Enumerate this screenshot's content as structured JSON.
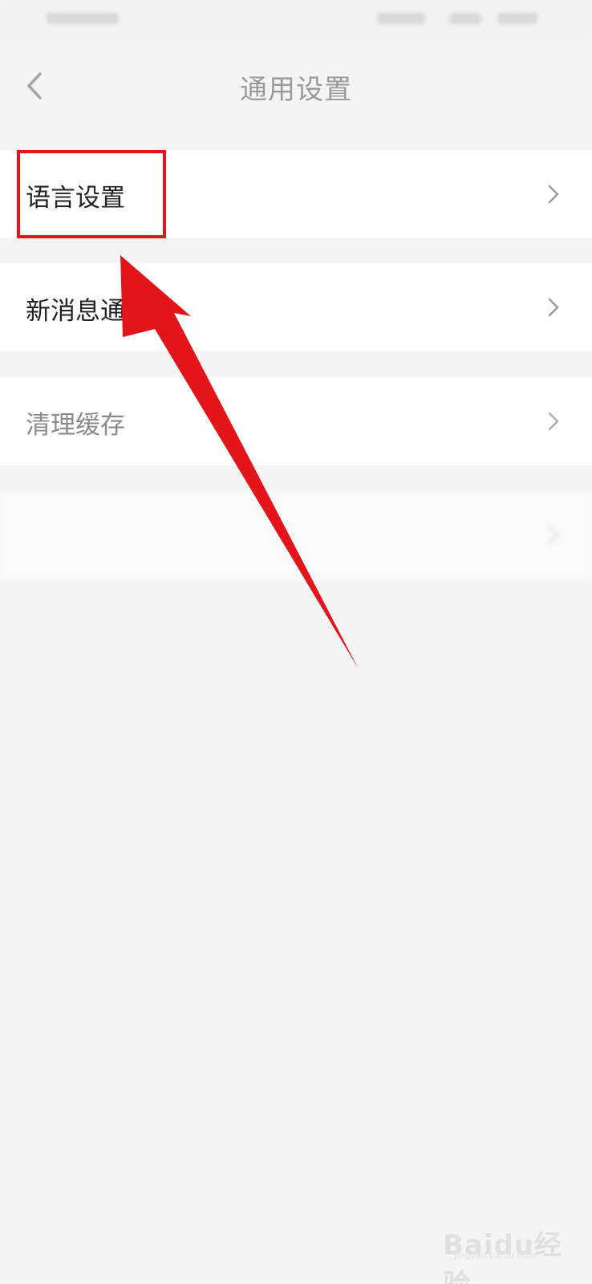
{
  "header": {
    "title": "通用设置"
  },
  "settings": {
    "items": [
      {
        "label": "语言设置"
      },
      {
        "label": "新消息通"
      },
      {
        "label": "清理缓存"
      },
      {
        "label": ""
      }
    ]
  },
  "annotation": {
    "color": "#e4141b"
  },
  "watermark": {
    "text": "Baidu经验",
    "sub": "jingyan.baidu.com"
  }
}
